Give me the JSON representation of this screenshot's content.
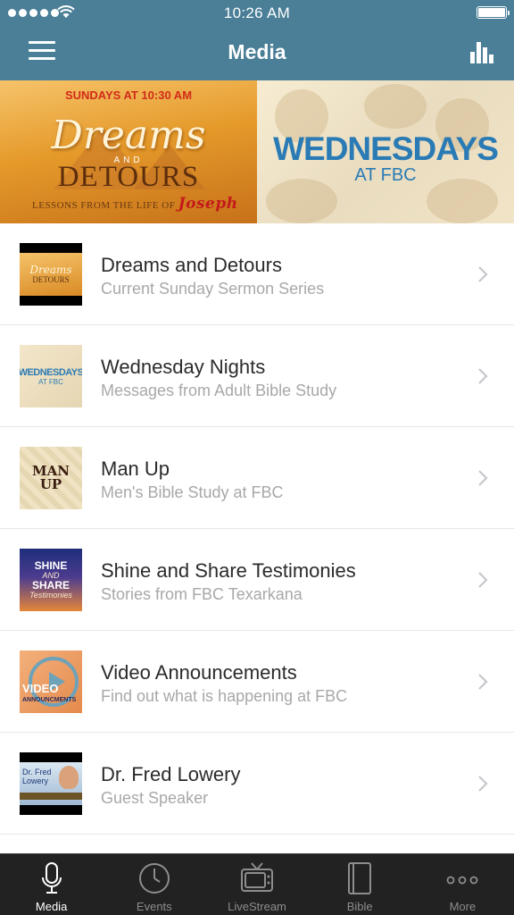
{
  "status": {
    "time": "10:26 AM"
  },
  "nav": {
    "title": "Media"
  },
  "banners": [
    {
      "top": "SUNDAYS AT 10:30 AM",
      "title": "Dreams",
      "and": "AND",
      "subtitle": "DETOURS",
      "footer": "LESSONS FROM THE LIFE OF",
      "footer_name": "Joseph"
    },
    {
      "title": "WEDNESDAYS",
      "subtitle": "AT FBC"
    }
  ],
  "list": [
    {
      "title": "Dreams and Detours",
      "subtitle": "Current Sunday Sermon Series",
      "thumb": {
        "a": "Dreams",
        "b": "DETOURS"
      }
    },
    {
      "title": "Wednesday Nights",
      "subtitle": "Messages from Adult Bible Study",
      "thumb": {
        "a": "WEDNESDAYS",
        "b": "AT FBC"
      }
    },
    {
      "title": "Man Up",
      "subtitle": "Men's Bible Study at FBC",
      "thumb": {
        "a": "MAN",
        "b": "UP"
      }
    },
    {
      "title": "Shine and Share Testimonies",
      "subtitle": "Stories from FBC Texarkana",
      "thumb": {
        "a": "SHINE",
        "and": "AND",
        "b": "SHARE",
        "c": "Testimonies"
      }
    },
    {
      "title": "Video Announcements",
      "subtitle": "Find out what is happening at FBC",
      "thumb": {
        "a": "VIDEO",
        "b": "ANNOUNCMENTS"
      }
    },
    {
      "title": "Dr. Fred Lowery",
      "subtitle": "Guest Speaker",
      "thumb": {
        "a": "Dr. Fred",
        "b": "Lowery"
      }
    }
  ],
  "tabs": [
    {
      "label": "Media",
      "icon": "microphone-icon",
      "active": true
    },
    {
      "label": "Events",
      "icon": "clock-icon",
      "active": false
    },
    {
      "label": "LiveStream",
      "icon": "tv-icon",
      "active": false
    },
    {
      "label": "Bible",
      "icon": "book-icon",
      "active": false
    },
    {
      "label": "More",
      "icon": "more-dots-icon",
      "active": false
    }
  ],
  "colors": {
    "header": "#4a7f97",
    "tabbar": "#222222",
    "accent_blue": "#2a7bb5"
  }
}
